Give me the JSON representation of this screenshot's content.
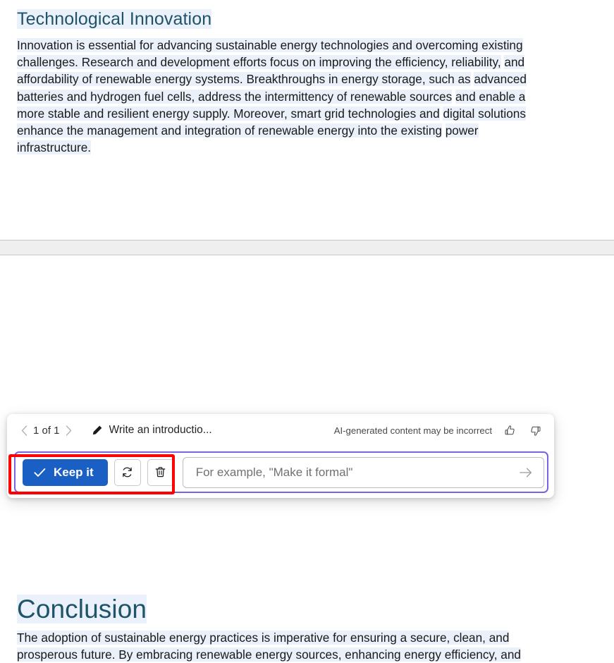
{
  "document": {
    "sections": [
      {
        "heading": "Technological Innovation",
        "paragraph_lines": [
          "Innovation is essential for advancing sustainable energy technologies and overcoming existing",
          "challenges. Research and development efforts focus on improving the efficiency, reliability,",
          "and affordability of renewable energy systems. Breakthroughs in energy storage, such as",
          "advanced batteries and hydrogen fuel cells, address the intermittency of renewable sources",
          "and enable a more stable and resilient energy supply. Moreover, smart grid technologies and",
          "digital solutions enhance the management and integration of renewable energy into the existing",
          "power infrastructure."
        ]
      },
      {
        "heading": "Conclusion",
        "paragraph_lines": [
          "The adoption of sustainable energy practices is imperative for ensuring a secure, clean, and",
          "prosperous future. By embracing renewable energy sources, enhancing energy efficiency, and"
        ]
      }
    ],
    "heading_color": "#1f5468",
    "selection_highlight_color": "#eaf1fa"
  },
  "ai_popup": {
    "navigation": {
      "previous_icon": "chevron-left-icon",
      "counter": "1 of 1",
      "next_icon": "chevron-right-icon"
    },
    "prompt_chip": {
      "icon": "pencil-icon",
      "label": "Write an introductio..."
    },
    "disclaimer": {
      "text": "AI-generated content may be incorrect",
      "thumbs_up_icon": "thumbs-up-icon",
      "thumbs_down_icon": "thumbs-down-icon"
    },
    "actions": {
      "keep_label": "Keep it",
      "keep_icon": "checkmark-icon",
      "regenerate_icon": "refresh-icon",
      "discard_icon": "trash-icon",
      "keep_button_color": "#1a5fc4"
    },
    "prompt_field": {
      "value": "",
      "placeholder": "For example, \"Make it formal\"",
      "send_icon": "arrow-right-icon"
    },
    "focus_ring_color": "#7b61e4",
    "annotation_color": "#ff0000"
  }
}
